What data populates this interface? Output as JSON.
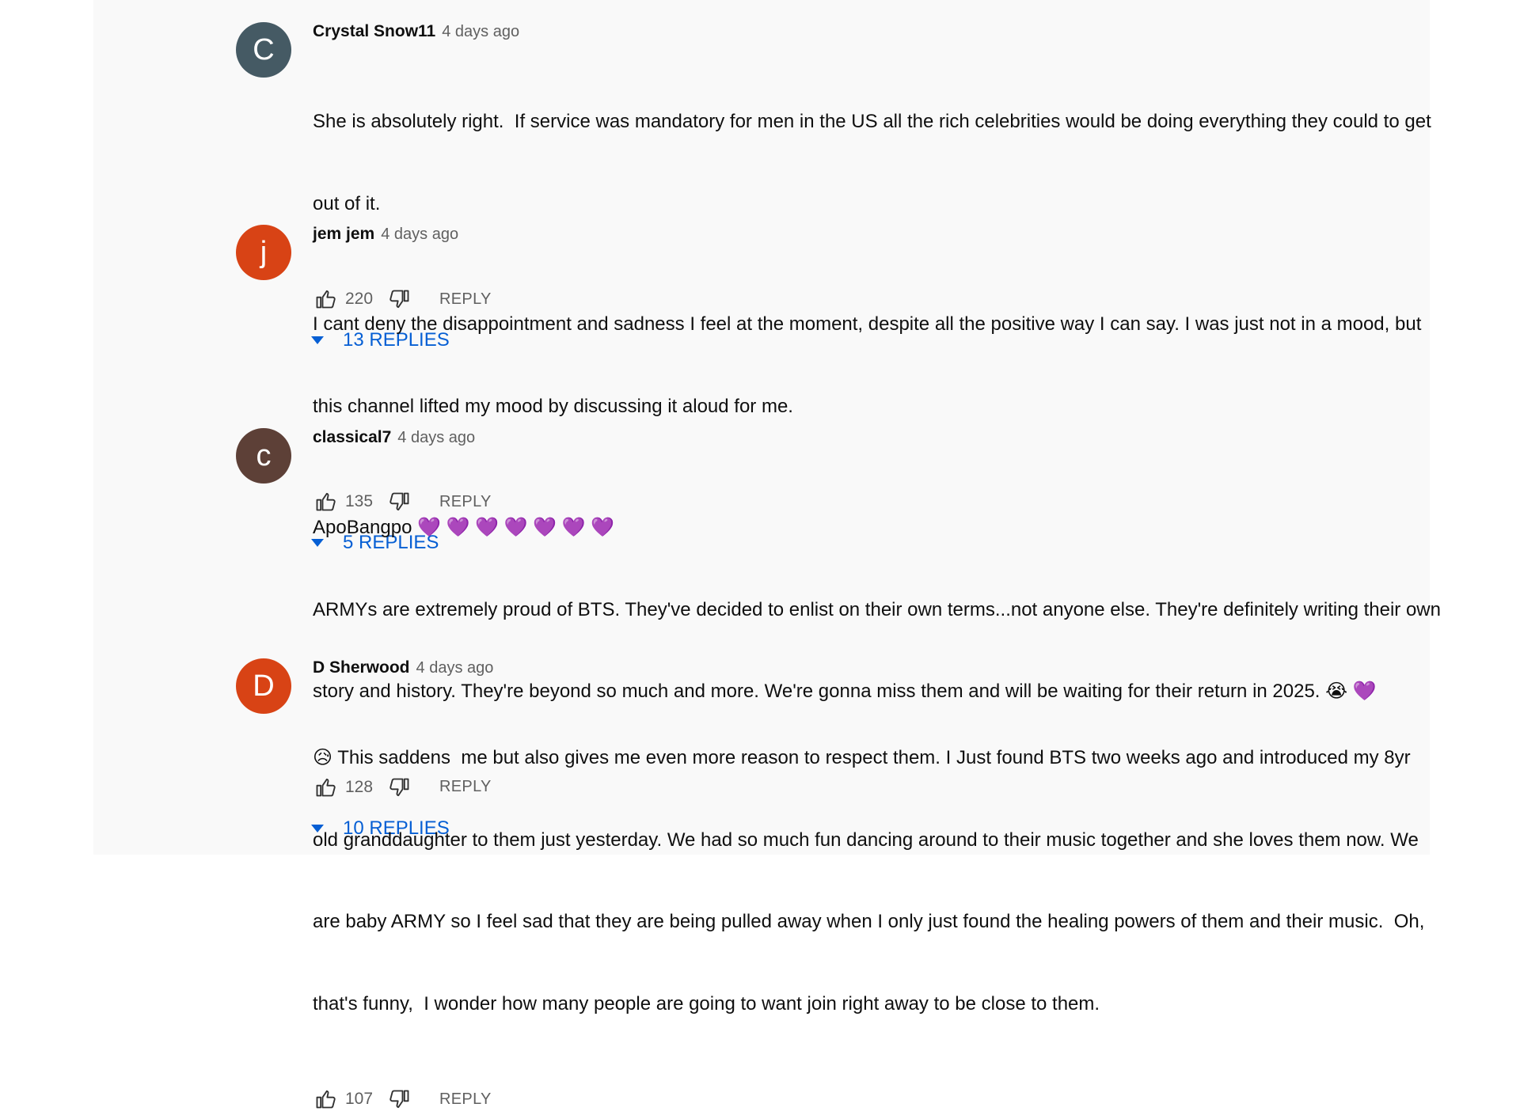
{
  "colors": {
    "panel_bg": "#f9f9f9",
    "link_blue": "#065fd4",
    "muted_text": "#606060"
  },
  "labels": {
    "reply": "REPLY"
  },
  "comments": [
    {
      "avatar_letter": "C",
      "avatar_color": "#455a64",
      "author": "Crystal Snow11",
      "time": "4 days ago",
      "lines": [
        "She is absolutely right.  If service was mandatory for men in the US all the rich celebrities would be doing everything they could to get",
        "out of it."
      ],
      "likes": "220",
      "replies": "13 REPLIES"
    },
    {
      "avatar_letter": "j",
      "avatar_color": "#d84315",
      "author": "jem jem",
      "time": "4 days ago",
      "lines": [
        "I cant deny the disappointment and sadness I feel at the moment, despite all the positive way I can say. I was just not in a mood, but",
        "this channel lifted my mood by discussing it aloud for me."
      ],
      "likes": "135",
      "replies": "5 REPLIES"
    },
    {
      "avatar_letter": "c",
      "avatar_color": "#5d4037",
      "author": "classical7",
      "time": "4 days ago",
      "lines": [
        "ApoBangpo 💜 💜 💜 💜 💜 💜 💜",
        "ARMYs are extremely proud of BTS. They've decided to enlist on their own terms...not anyone else. They're definitely writing their own",
        "story and history. They're beyond so much and more. We're gonna miss them and will be waiting for their return in 2025. 😭 💜"
      ],
      "likes": "128",
      "replies": "10 REPLIES"
    },
    {
      "avatar_letter": "D",
      "avatar_color": "#d84315",
      "author": "D Sherwood",
      "time": "4 days ago",
      "lines": [
        "😥 This saddens  me but also gives me even more reason to respect them. I Just found BTS two weeks ago and introduced my 8yr",
        "old granddaughter to them just yesterday. We had so much fun dancing around to their music together and she loves them now. We",
        "are baby ARMY so I feel sad that they are being pulled away when I only just found the healing powers of them and their music.  Oh,",
        "that's funny,  I wonder how many people are going to want join right away to be close to them."
      ],
      "likes": "107",
      "replies": ""
    }
  ]
}
